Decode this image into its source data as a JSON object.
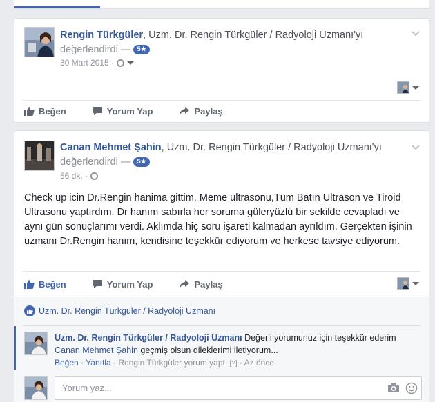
{
  "post1": {
    "author": "Rengin Türkgüler",
    "page_name": "Uzm. Dr. Rengin Türkgüler / Radyoloji Uzmanı",
    "possessive": "'yı",
    "verb": "değerlendirdi —",
    "rating": "5★",
    "date": "30 Mart 2015 ·"
  },
  "post2": {
    "author": "Canan Mehmet Şahin",
    "page_name": "Uzm. Dr. Rengin Türkgüler / Radyoloji Uzmanı",
    "possessive": "'yı",
    "verb": "değerlendirdi —",
    "rating": "5★",
    "date": "56 dk. ·",
    "body": "Check up icin Dr.Rengin hanima gittim. Meme ultrasonu,Tüm Batın Ultrason ve Tiroid Ultrasonu yaptırdım. Dr hanım sabırla her soruma güleryüzlü bir sekilde cevapladı ve aynı gün sonuçlarımı verdi. Aklımda hiç soru işareti kalmadan ayrıldım. Gerçekten işinin uzmanı Dr.Rengin hanım, kendisine teşekkür ediyorum ve herkese tavsiye ediyorum."
  },
  "actions": {
    "like": "Beğen",
    "comment": "Yorum Yap",
    "share": "Paylaş"
  },
  "comments": {
    "liked_by": "Uzm. Dr. Rengin Türkgüler / Radyoloji Uzmanı",
    "reply": {
      "author": "Uzm. Dr. Rengin Türkgüler / Radyoloji Uzmanı",
      "text_1": "Değerli yorumunuz için teşekkür ederim",
      "mention": "Canan Mehmet Şahin",
      "text_2": "geçmiş olsun dileklerimi iletiyorum...",
      "like": "Beğen",
      "sep1": "·",
      "reply": "Yanıtla",
      "sep2": "·",
      "posted_by": "Rengin Türkgüler yorum yaptı",
      "help": "[?]",
      "sep3": "·",
      "time": "Az önce"
    },
    "composer_placeholder": "Yorum yaz..."
  },
  "colors": {
    "brand": "#4267b2",
    "link": "#365899",
    "muted": "#90949c",
    "background": "#e9ebee"
  },
  "icons": [
    "chevron-down-icon",
    "globe-icon",
    "like-icon",
    "comment-icon",
    "share-icon",
    "camera-icon",
    "emoji-icon",
    "caret-down-icon"
  ]
}
